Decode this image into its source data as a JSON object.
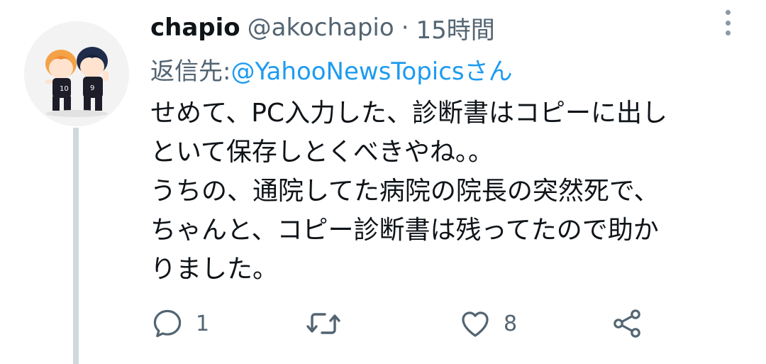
{
  "tweet": {
    "display_name": "chapio",
    "handle": "@akochapio",
    "separator": "·",
    "time": "15時間",
    "reply_prefix": "返信先: ",
    "reply_target": "@YahooNewsTopicsさん",
    "body_lines": [
      "せめて、PC入力した、診断書はコピーに出し",
      "といて保存しとくべきやね。。",
      "うちの、通院してた病院の院長の突然死で、",
      "ちゃんと、コピー診断書は残ってたので助か",
      "りました。"
    ],
    "actions": {
      "reply_count": "1",
      "retweet_count": "",
      "like_count": "8"
    }
  },
  "icons": {
    "avatar": "avatar-illustration",
    "more": "more-vertical-icon",
    "reply": "reply-icon",
    "retweet": "retweet-icon",
    "like": "heart-icon",
    "share": "share-icon"
  },
  "colors": {
    "text": "#0f1419",
    "secondary": "#536471",
    "link": "#1d9bf0",
    "thread_line": "#cfd9de"
  }
}
